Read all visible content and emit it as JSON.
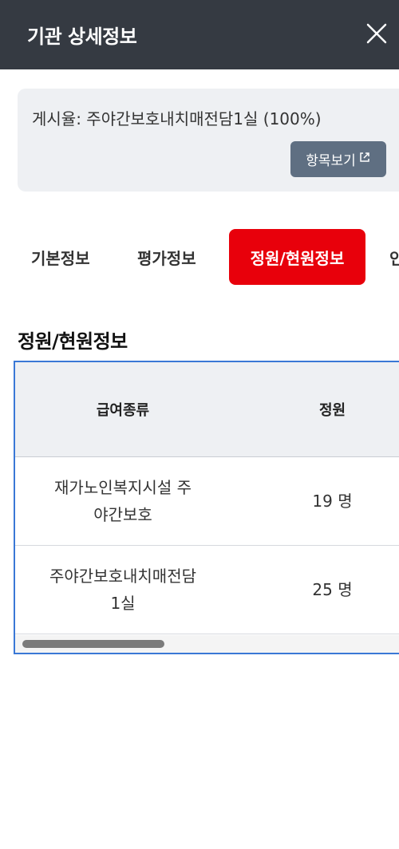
{
  "header": {
    "title": "기관 상세정보",
    "close_icon": "close-icon"
  },
  "notice": {
    "text": "게시율: 주야간보호내치매전담1실 (100%)",
    "button_label": "항목보기",
    "button_icon": "external-link-icon"
  },
  "tabs": [
    {
      "label": "기본정보",
      "active": false
    },
    {
      "label": "평가정보",
      "active": false
    },
    {
      "label": "정원/현원정보",
      "active": true
    },
    {
      "label": "인",
      "active": false
    }
  ],
  "section": {
    "title": "정원/현원정보"
  },
  "table": {
    "headers": [
      "급여종류",
      "정원"
    ],
    "rows": [
      {
        "type_line1": "재가노인복지시설 주",
        "type_line2": "야간보호",
        "capacity": "19 명"
      },
      {
        "type_line1": "주야간보호내치매전담",
        "type_line2": "1실",
        "capacity": "25 명"
      }
    ]
  },
  "colors": {
    "active_tab": "#e8000b",
    "header_bg": "#353a42",
    "table_border": "#3a78d6"
  }
}
